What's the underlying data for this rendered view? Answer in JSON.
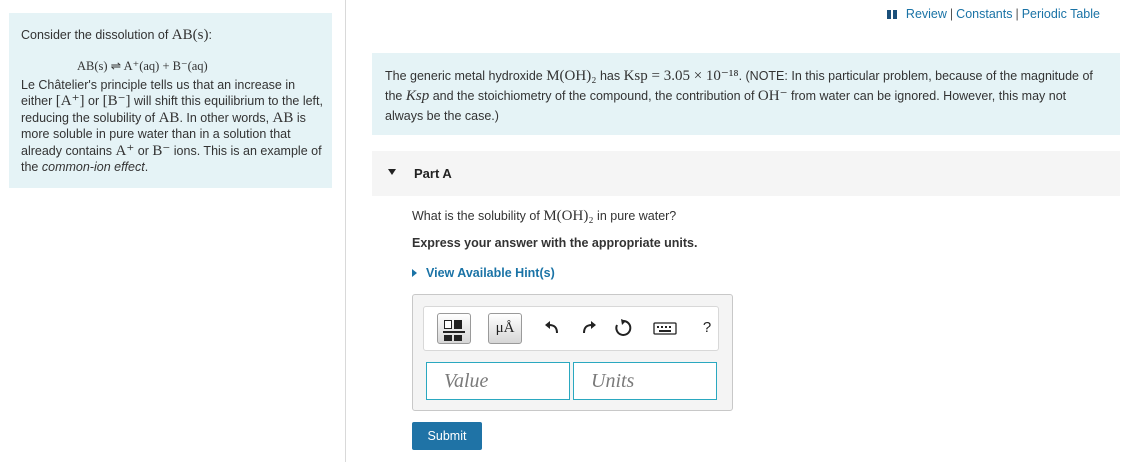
{
  "top_links": {
    "review": "Review",
    "constants": "Constants",
    "periodic_table": "Periodic Table",
    "separator": "|"
  },
  "left_panel": {
    "intro": "Consider the dissolution of",
    "intro_species": "AB(s)",
    "equation": "AB(s) ⇌ A⁺(aq) + B⁻(aq)",
    "body_1": "Le Châtelier's principle tells us that an increase in either",
    "ion_a": "[A⁺]",
    "or_1": "or",
    "ion_b": "[B⁻]",
    "body_2": "will shift this equilibrium to the left, reducing the solubility of",
    "species_ab": "AB",
    "body_3": ". In other words,",
    "species_ab_2": "AB",
    "body_4": "is more soluble in pure water than in a solution that already contains",
    "ion_a2": "A⁺",
    "or_2": "or",
    "ion_b2": "B⁻",
    "body_5": "ions. This is an example of the",
    "emphasis": "common-ion effect",
    "period": "."
  },
  "problem": {
    "t1": "The generic metal hydroxide",
    "compound": "M(OH)₂",
    "t2": "has",
    "ksp_expr": "Ksp = 3.05 × 10⁻¹⁸",
    "t3": ". (NOTE: In this particular problem, because of the magnitude of the",
    "ksp_ref": "Ksp",
    "t4": "and the stoichiometry of the compound, the contribution of",
    "hydroxide": "OH⁻",
    "t5": "from water can be ignored. However, this may not always be the case.)"
  },
  "part": {
    "label": "Part A",
    "question_1": "What is the solubility of",
    "question_compound": "M(OH)₂",
    "question_2": "in pure water?",
    "instruction": "Express your answer with the appropriate units.",
    "hint_label": "View Available Hint(s)"
  },
  "answer": {
    "unit_button_label": "μÅ",
    "help_label": "?",
    "value_placeholder": "Value",
    "units_placeholder": "Units",
    "submit_label": "Submit"
  },
  "icons": {
    "templates": "templates-icon",
    "units": "units-icon",
    "undo": "undo-icon",
    "redo": "redo-icon",
    "reset": "reset-icon",
    "keyboard": "keyboard-icon",
    "help": "help-icon"
  },
  "colors": {
    "panel_bg": "#e5f3f6",
    "link": "#1a73a6",
    "submit_bg": "#1f73a6",
    "field_border": "#2aa8c0"
  }
}
